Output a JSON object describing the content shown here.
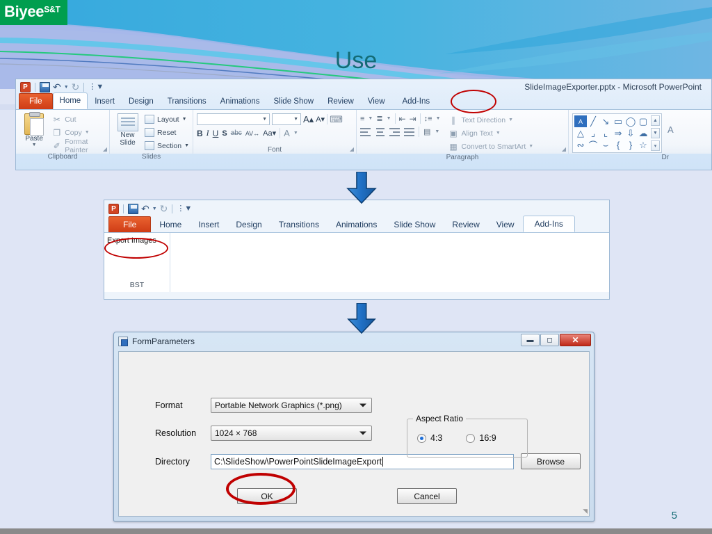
{
  "slide": {
    "title": "Use",
    "page_number": "5",
    "logo": {
      "main": "Biyee",
      "sup": "S&T"
    },
    "colors": {
      "title": "#136b75",
      "logo_bg": "#009e4f",
      "annotation": "#c00000",
      "arrow": "#2a7fd4",
      "slide_bg": "#dfe5f5"
    }
  },
  "arrows": [
    {
      "name": "flow-arrow-1"
    },
    {
      "name": "flow-arrow-2"
    }
  ],
  "powerpoint_window": {
    "title": "SlideImageExporter.pptx  -  Microsoft PowerPoint",
    "quick_access": {
      "app_icon": "powerpoint-icon",
      "save": "save-icon",
      "undo": "undo-icon",
      "redo": "redo-icon",
      "customize": "customize-qat-icon"
    },
    "tabs": [
      {
        "label": "File",
        "state": "file"
      },
      {
        "label": "Home",
        "state": "active"
      },
      {
        "label": "Insert",
        "state": "normal"
      },
      {
        "label": "Design",
        "state": "normal"
      },
      {
        "label": "Transitions",
        "state": "normal"
      },
      {
        "label": "Animations",
        "state": "normal"
      },
      {
        "label": "Slide Show",
        "state": "normal"
      },
      {
        "label": "Review",
        "state": "normal"
      },
      {
        "label": "View",
        "state": "normal"
      },
      {
        "label": "Add-Ins",
        "state": "normal",
        "annotated": true
      }
    ],
    "groups": {
      "clipboard": {
        "label": "Clipboard",
        "paste": "Paste",
        "items": [
          "Cut",
          "Copy",
          "Format Painter"
        ]
      },
      "slides": {
        "label": "Slides",
        "new_slide": "New\nSlide",
        "new_slide_line1": "New",
        "new_slide_line2": "Slide",
        "items": [
          "Layout",
          "Reset",
          "Section"
        ]
      },
      "font": {
        "label": "Font",
        "font_name_value": "",
        "font_size_value": "",
        "buttons": [
          "B",
          "I",
          "U",
          "S",
          "abc",
          "AV",
          "Aa",
          "A"
        ]
      },
      "paragraph": {
        "label": "Paragraph",
        "items": [
          "Text Direction",
          "Align Text",
          "Convert to SmartArt"
        ]
      },
      "drawing": {
        "label": "Dr"
      }
    }
  },
  "addins_window": {
    "tabs": [
      {
        "label": "File",
        "state": "file"
      },
      {
        "label": "Home",
        "state": "normal"
      },
      {
        "label": "Insert",
        "state": "normal"
      },
      {
        "label": "Design",
        "state": "normal"
      },
      {
        "label": "Transitions",
        "state": "normal"
      },
      {
        "label": "Animations",
        "state": "normal"
      },
      {
        "label": "Slide Show",
        "state": "normal"
      },
      {
        "label": "Review",
        "state": "normal"
      },
      {
        "label": "View",
        "state": "normal"
      },
      {
        "label": "Add-Ins",
        "state": "active"
      }
    ],
    "export_button": "Export Images",
    "group_label": "BST"
  },
  "dialog": {
    "title": "FormParameters",
    "window_buttons": {
      "minimize": "minimize-icon",
      "maximize": "maximize-icon",
      "close": "close-icon"
    },
    "fields": {
      "format": {
        "label": "Format",
        "value": "Portable Network Graphics (*.png)"
      },
      "resolution": {
        "label": "Resolution",
        "value": "1024 × 768"
      },
      "directory": {
        "label": "Directory",
        "value": "C:\\SlideShow\\PowerPointSlideImageExport",
        "browse_label": "Browse"
      }
    },
    "aspect_ratio": {
      "legend": "Aspect Ratio",
      "options": [
        {
          "label": "4:3",
          "selected": true
        },
        {
          "label": "16:9",
          "selected": false
        }
      ]
    },
    "buttons": {
      "ok": "OK",
      "cancel": "Cancel"
    }
  }
}
